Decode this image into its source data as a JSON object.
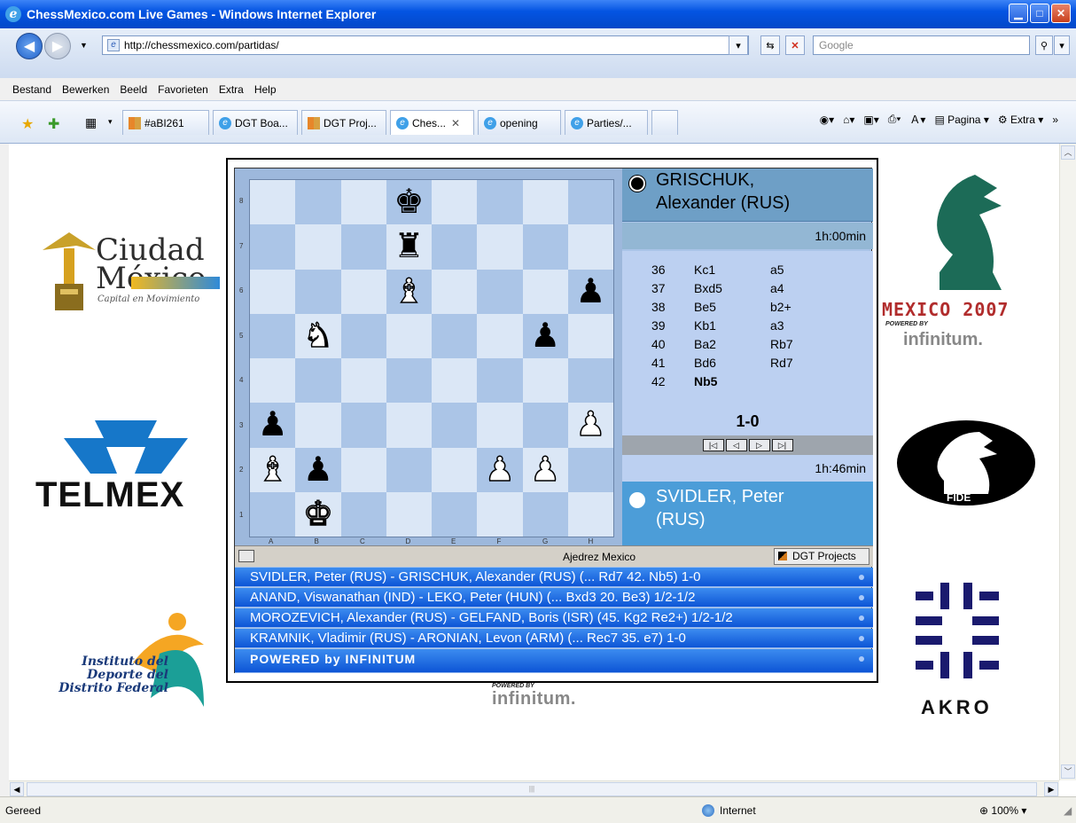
{
  "window": {
    "title": "ChessMexico.com Live Games - Windows Internet Explorer"
  },
  "address": {
    "url": "http://chessmexico.com/partidas/",
    "search_placeholder": "Google"
  },
  "menu": [
    "Bestand",
    "Bewerken",
    "Beeld",
    "Favorieten",
    "Extra",
    "Help"
  ],
  "tabs": [
    "#aBI261",
    "DGT Boa...",
    "DGT Proj...",
    "Ches...",
    "opening",
    "Parties/..."
  ],
  "toolbar": {
    "page_label": "Pagina",
    "extra_label": "Extra"
  },
  "status": {
    "left": "Gereed",
    "zone": "Internet",
    "zoom": "100%"
  },
  "logos": {
    "ciudad": "Ciudad México",
    "ciudad_sub": "Capital en Movimiento",
    "telmex": "TELMEX",
    "instituto": [
      "Instituto del",
      "Deporte del",
      "Distrito Federal"
    ],
    "mexico2007": "MEXICO 2007",
    "powered_by": "POWERED BY",
    "infinitum": "infinitum.",
    "fide": "FIDE",
    "akro": "AKRO"
  },
  "widget": {
    "black_player_line1": "GRISCHUK,",
    "black_player_line2": "Alexander (RUS)",
    "black_clock": "1h:00min",
    "white_clock": "1h:46min",
    "white_player_line1": "SVIDLER, Peter",
    "white_player_line2": "(RUS)",
    "result": "1-0",
    "moves": [
      {
        "n": "36",
        "w": "Kc1",
        "b": "a5"
      },
      {
        "n": "37",
        "w": "Bxd5",
        "b": "a4"
      },
      {
        "n": "38",
        "w": "Be5",
        "b": "b2+"
      },
      {
        "n": "39",
        "w": "Kb1",
        "b": "a3"
      },
      {
        "n": "40",
        "w": "Ba2",
        "b": "Rb7"
      },
      {
        "n": "41",
        "w": "Bd6",
        "b": "Rd7"
      },
      {
        "n": "42",
        "w": "Nb5",
        "b": ""
      }
    ],
    "files": [
      "A",
      "B",
      "C",
      "D",
      "E",
      "F",
      "G",
      "H"
    ],
    "ranks": [
      "8",
      "7",
      "6",
      "5",
      "4",
      "3",
      "2",
      "1"
    ],
    "footer_center": "Ajedrez Mexico",
    "footer_button": "DGT Projects",
    "games": [
      "SVIDLER, Peter (RUS) - GRISCHUK, Alexander (RUS) (... Rd7 42. Nb5) 1-0",
      "ANAND, Viswanathan (IND) - LEKO, Peter (HUN) (... Bxd3 20. Be3) 1/2-1/2",
      "MOROZEVICH, Alexander (RUS) - GELFAND, Boris (ISR) (45. Kg2 Re2+) 1/2-1/2",
      "KRAMNIK, Vladimir (RUS) - ARONIAN, Levon (ARM) (... Rec7 35. e7) 1-0"
    ],
    "powered": "POWERED by INFINITUM",
    "board": [
      [
        "",
        "",
        "",
        "bk",
        "",
        "",
        "",
        ""
      ],
      [
        "",
        "",
        "",
        "br",
        "",
        "",
        "",
        ""
      ],
      [
        "",
        "",
        "",
        "wb",
        "",
        "",
        "",
        "bp"
      ],
      [
        "",
        "wn",
        "",
        "",
        "",
        "",
        "bp",
        ""
      ],
      [
        "",
        "",
        "",
        "",
        "",
        "",
        "",
        ""
      ],
      [
        "bp",
        "",
        "",
        "",
        "",
        "",
        "",
        "wp"
      ],
      [
        "wb",
        "bp",
        "",
        "",
        "",
        "wp",
        "wp",
        ""
      ],
      [
        "",
        "wk",
        "",
        "",
        "",
        "",
        "",
        ""
      ]
    ]
  }
}
